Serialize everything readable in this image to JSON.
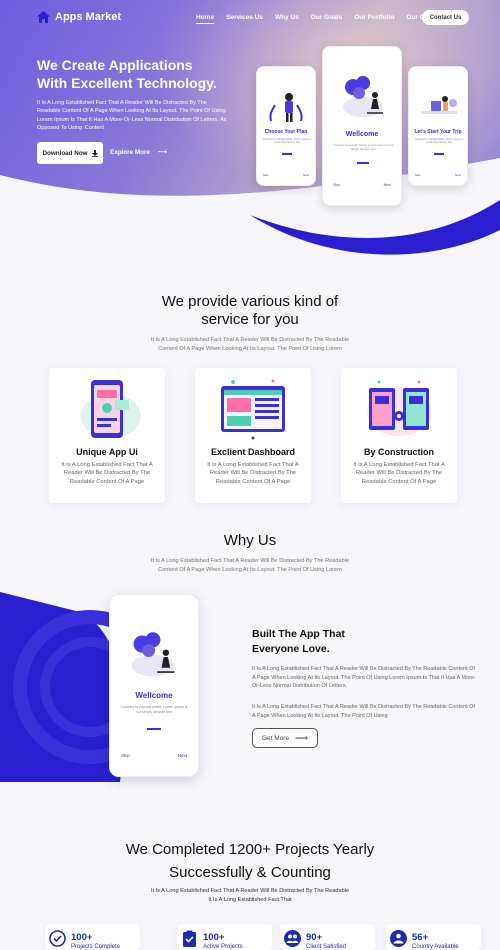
{
  "nav": {
    "brand": "Apps Market",
    "links": [
      {
        "label": "Home"
      },
      {
        "label": "Services Us"
      },
      {
        "label": "Why Us"
      },
      {
        "label": "Our Goals"
      },
      {
        "label": "Our Portfolio"
      },
      {
        "label": "Our Client"
      }
    ],
    "contact_label": "Contact Us"
  },
  "hero": {
    "title_line1": "We Create Applications",
    "title_line2": "With Excellent Technology.",
    "description": "It Is A Long Established Fact That A Reader Will Be Distracted By The Readable Content Of A Page When Looking At Its Layout. The Point Of Using Lorem Ipsum Is That It Has A More-Or-Less Normal Distribution Of Letters, As Opposed To Using 'Content",
    "download_label": "Download Now",
    "explore_label": "Explore More",
    "phones": [
      {
        "title": "Choose Your Plan",
        "text": "Contrary to popular belief, Lorem Ipsum is not simply random text",
        "skip": "Skip",
        "next": "Next"
      },
      {
        "title": "Wellcome",
        "text": "Contrary to popular belief, Lorem Ipsum is not simply random text",
        "skip": "Skip",
        "next": "Next"
      },
      {
        "title": "Let's Start Your Trip",
        "text": "Contrary to popular belief, Lorem Ipsum is not simply random text",
        "skip": "Skip",
        "next": "Next"
      }
    ]
  },
  "services": {
    "title_line1": "We provide various kind of",
    "title_line2": "service for you",
    "subtitle_line1": "It Is A Long Established Fact That A Reader Will Be Distracted By The Readable",
    "subtitle_line2": "Content Of A Page When Looking At Its Layout. The Point Of Using Lorem",
    "cards": [
      {
        "title": "Unique App Ui",
        "text": "It Is A Long Established Fact That A Reader Will Be Distracted By The Readable Content Of A Page"
      },
      {
        "title": "Exclient Dashboard",
        "text": "It Is A Long Established Fact That A Reader Will Be Distracted By The Readable Content Of A Page"
      },
      {
        "title": "By Construction",
        "text": "It Is A Long Established Fact That A Reader Will Be Distracted By The Readable Content Of A Page"
      }
    ]
  },
  "why": {
    "title": "Why Us",
    "subtitle_line1": "It Is A Long Established Fact That A Reader Will Be Distracted By The Readable",
    "subtitle_line2": "Content Of A Page When Looking At Its Layout. The Point Of Using Lorem",
    "phone": {
      "title": "Wellcome",
      "text": "Contrary to popular belief, Lorem Ipsum is not simply random text",
      "skip": "Skip",
      "next": "Next"
    },
    "built_line1": "Built The App That",
    "built_line2": "Everyone Love.",
    "para1": "It Is A Long Established Fact That A Reader Will Be Distracted By The Readable Content Of A Page When Looking At Its Layout. The Point Of Using Lorem Ipsum Is That It Has A More-Or-Less Normal Distribution Of Letters,",
    "para2": "It Is A Long Established Fact That A Reader Will Be Distracted By The Readable Content Of A Page When Looking At Its Layout. The Point Of Using",
    "getmore_label": "Get More"
  },
  "completed": {
    "title_line1": "We Completed 1200+ Projects Yearly",
    "title_line2": "Successfully & Counting",
    "subtitle_line1": "It Is A Long Established Fact That A Reader Will Be Distracted By The Readable",
    "subtitle_line2": "It Is A Long Established Fact That",
    "stats": [
      {
        "number": "100+",
        "label": "Projects Complete"
      },
      {
        "number": "100+",
        "label": "Active Projects"
      },
      {
        "number": "90+",
        "label": "Client Satisfied"
      },
      {
        "number": "56+",
        "label": "Country Available"
      }
    ]
  },
  "colors": {
    "brand_blue": "#2a1fd0",
    "accent_purple": "#6f5de0"
  }
}
